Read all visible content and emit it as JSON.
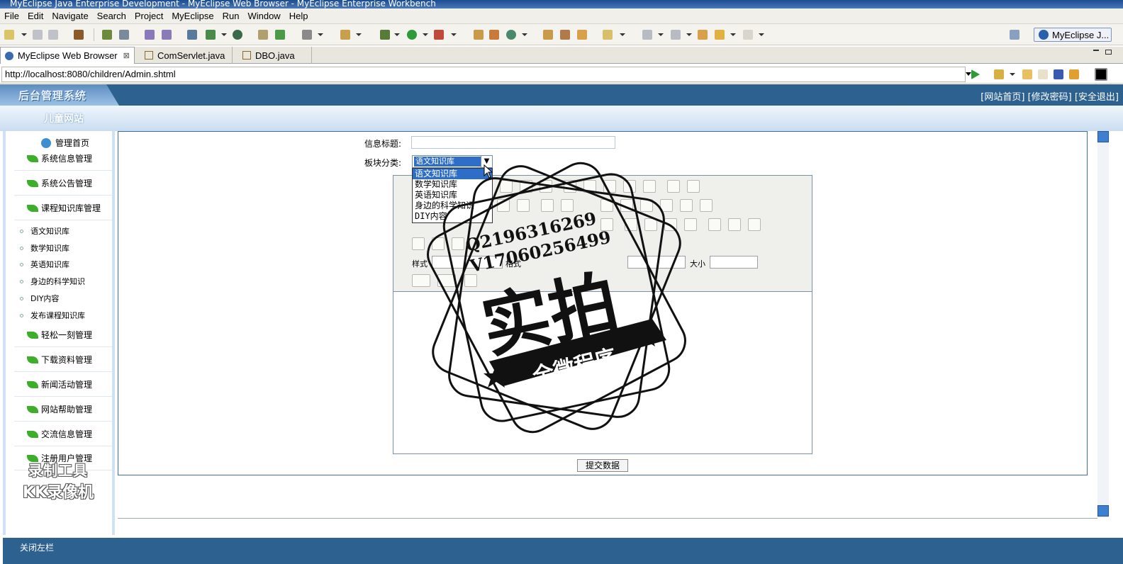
{
  "window": {
    "title": "MyEclipse Java Enterprise Development - MyEclipse Web Browser - MyEclipse Enterprise Workbench"
  },
  "menu": [
    "File",
    "Edit",
    "Navigate",
    "Search",
    "Project",
    "MyEclipse",
    "Run",
    "Window",
    "Help"
  ],
  "perspective": "MyEclipse J...",
  "tabs": [
    {
      "label": "MyEclipse Web Browser",
      "close": "⊠"
    },
    {
      "label": "ComServlet.java"
    },
    {
      "label": "DBO.java"
    }
  ],
  "address": {
    "url": "http://localhost:8080/children/Admin.shtml"
  },
  "site": {
    "logo": "后台管理系统",
    "name": "儿童网站",
    "top_links": "[网站首页] [修改密码] [安全退出]",
    "close_left": "关闭左栏"
  },
  "sidebar": {
    "home": "管理首页",
    "items": [
      "系统信息管理",
      "系统公告管理",
      "课程知识库管理"
    ],
    "sub_items": [
      "语文知识库",
      "数学知识库",
      "英语知识库",
      "身边的科学知识",
      "DIY内容",
      "发布课程知识库"
    ],
    "items2": [
      "轻松一刻管理",
      "下载资料管理",
      "新闻活动管理",
      "网站帮助管理",
      "交流信息管理",
      "注册用户管理"
    ]
  },
  "form": {
    "title_label": "信息标题:",
    "title_value": "",
    "category_label": "板块分类:",
    "category_selected": "语文知识库",
    "category_options": [
      "语文知识库",
      "数学知识库",
      "英语知识库",
      "身边的科学知识",
      "DIY内容"
    ],
    "style_label": "样式",
    "format_label": "格式",
    "size_label": "大小",
    "submit_label": "提交数据"
  },
  "watermarks": {
    "stamp_qq": "Q2196316269",
    "stamp_v": "V17060256499",
    "stamp_big": "实拍",
    "stamp_banner": "全微程序",
    "recorder_line1": "录制工具",
    "recorder_line2": "KK录像机"
  },
  "colors": {
    "banner": "#2c6190",
    "selection": "#2e6ec9"
  }
}
